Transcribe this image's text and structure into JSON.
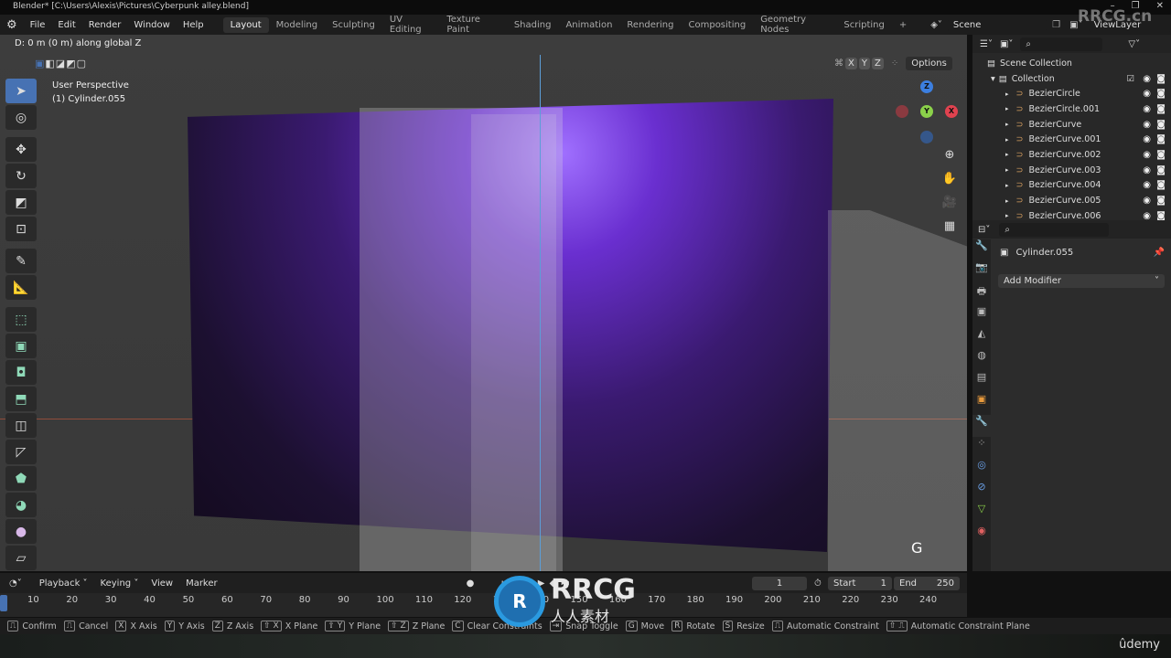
{
  "window": {
    "title": "Blender* [C:\\Users\\Alexis\\Pictures\\Cyberpunk alley.blend]",
    "minimize": "–",
    "maximize": "❐",
    "close": "✕"
  },
  "menu": {
    "items": [
      "File",
      "Edit",
      "Render",
      "Window",
      "Help"
    ]
  },
  "workspaces": [
    "Layout",
    "Modeling",
    "Sculpting",
    "UV Editing",
    "Texture Paint",
    "Shading",
    "Animation",
    "Rendering",
    "Compositing",
    "Geometry Nodes",
    "Scripting",
    "+"
  ],
  "active_workspace": "Layout",
  "scene": {
    "name": "Scene",
    "view_layer": "ViewLayer"
  },
  "viewport": {
    "header_status": "D: 0 m (0 m) along global Z",
    "perspective": "User Perspective",
    "object": "(1) Cylinder.055",
    "axes": [
      "X",
      "Y",
      "Z"
    ],
    "options": "Options",
    "key_overlay": "G",
    "gizmo": {
      "x": "X",
      "y": "Y",
      "z": "Z"
    }
  },
  "toolbar": {
    "tools": [
      "select-box",
      "cursor",
      "move",
      "rotate",
      "scale",
      "transform",
      "annotate",
      "measure",
      "add-cube",
      "extrude",
      "inset",
      "bevel",
      "loop-cut",
      "knife",
      "poly-build",
      "spin",
      "smooth",
      "shear"
    ]
  },
  "outliner": {
    "root": "Scene Collection",
    "collection": "Collection",
    "items": [
      "BezierCircle",
      "BezierCircle.001",
      "BezierCurve",
      "BezierCurve.001",
      "BezierCurve.002",
      "BezierCurve.003",
      "BezierCurve.004",
      "BezierCurve.005",
      "BezierCurve.006"
    ]
  },
  "properties": {
    "object_name": "Cylinder.055",
    "add_modifier": "Add Modifier"
  },
  "timeline": {
    "menus": [
      "Playback",
      "Keying",
      "View",
      "Marker"
    ],
    "current_frame": "1",
    "start_label": "Start",
    "start": "1",
    "end_label": "End",
    "end": "250",
    "ticks": [
      "10",
      "20",
      "30",
      "40",
      "50",
      "60",
      "70",
      "80",
      "90",
      "100",
      "110",
      "120",
      "130",
      "140",
      "150",
      "160",
      "170",
      "180",
      "190",
      "200",
      "210",
      "220",
      "230",
      "240"
    ]
  },
  "statusbar": [
    {
      "key": "⎍",
      "label": "Confirm"
    },
    {
      "key": "⎍",
      "label": "Cancel"
    },
    {
      "key": "X",
      "label": "X Axis"
    },
    {
      "key": "Y",
      "label": "Y Axis"
    },
    {
      "key": "Z",
      "label": "Z Axis"
    },
    {
      "key": "⇧ X",
      "label": "X Plane"
    },
    {
      "key": "⇧ Y",
      "label": "Y Plane"
    },
    {
      "key": "⇧ Z",
      "label": "Z Plane"
    },
    {
      "key": "C",
      "label": "Clear Constraints"
    },
    {
      "key": "⇥",
      "label": "Snap Toggle"
    },
    {
      "key": "G",
      "label": "Move"
    },
    {
      "key": "R",
      "label": "Rotate"
    },
    {
      "key": "S",
      "label": "Resize"
    },
    {
      "key": "⎍",
      "label": "Automatic Constraint"
    },
    {
      "key": "⇧ ⎍",
      "label": "Automatic Constraint Plane"
    }
  ],
  "watermarks": {
    "corner": "RRCG.cn",
    "center": "RRCG",
    "center_sub": "人人素材",
    "udemy": "ûdemy"
  },
  "colors": {
    "accent": "#4772b3",
    "x_axis": "#e0424f",
    "y_axis": "#8bd14a",
    "z_axis": "#3c7fe0"
  }
}
